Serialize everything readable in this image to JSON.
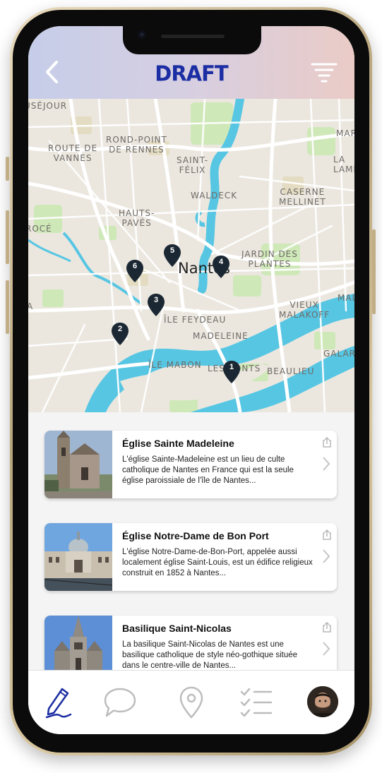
{
  "header": {
    "title": "DRAFT",
    "title_color": "#1c2ea3",
    "back_icon": "chevron-left-icon",
    "filter_icon": "filter-icon"
  },
  "map": {
    "city": "Nantes",
    "labels": {
      "sejour": "USÉJOUR",
      "rond_point": "ROND-POINT\nDE RENNES",
      "route_vannes": "ROUTE DE\nVANNES",
      "saint_felix": "SAINT-\nFÉLIX",
      "ma": "MAR",
      "la": "LA\nLAME",
      "waldeck": "WALDECK",
      "caserne": "CASERNE\nMELLINET",
      "hauts_paves": "HAUTS-\nPAVÉS",
      "roce": "ROCÉ",
      "jardin": "JARDIN DES\nPLANTES",
      "a": "A",
      "ile_feydeau": "ÎLE FEYDEAU",
      "vieux_malakoff": "VIEUX\nMALAKOFF",
      "mal": "MAL",
      "madeleine": "MADELEINE",
      "ile_mabon": "ÎLE MABON",
      "les_ponts": "LES PONTS",
      "beaulieu": "BEAULIEU",
      "galarne": "GALARN"
    },
    "pins": [
      "1",
      "2",
      "3",
      "4",
      "5",
      "6"
    ]
  },
  "places": [
    {
      "title": "Église Sainte Madeleine",
      "description": "L'église Sainte-Madeleine est un lieu de culte catholique de Nantes en France qui est la seule église paroissiale de l'île de Nantes..."
    },
    {
      "title": "Église Notre-Dame de Bon Port",
      "description": "L'église Notre-Dame-de-Bon-Port, appelée aussi localement église Saint-Louis, est un édifice religieux construit en 1852 à Nantes..."
    },
    {
      "title": "Basilique Saint-Nicolas",
      "description": "La basilique Saint-Nicolas de Nantes est une basilique catholique de style néo-gothique située dans le centre-ville de Nantes..."
    }
  ],
  "nav": {
    "items": [
      "pen-icon",
      "chat-bubble-icon",
      "location-pin-icon",
      "checklist-icon",
      "user-avatar"
    ],
    "active": "pen-icon",
    "active_color": "#1c2ea3"
  }
}
